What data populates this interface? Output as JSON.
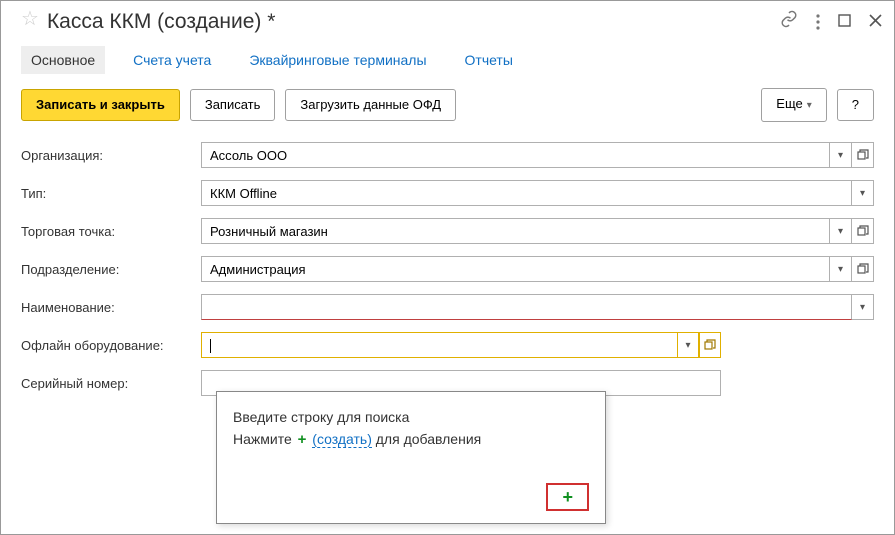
{
  "title": "Касса ККМ (создание) *",
  "tabs": {
    "main": "Основное",
    "accounts": "Счета учета",
    "terminals": "Эквайринговые терминалы",
    "reports": "Отчеты"
  },
  "toolbar": {
    "save_close": "Записать и закрыть",
    "save": "Записать",
    "load_ofd": "Загрузить данные ОФД",
    "more": "Еще",
    "help": "?"
  },
  "fields": {
    "org": {
      "label": "Организация:",
      "value": "Ассоль ООО"
    },
    "type": {
      "label": "Тип:",
      "value": "ККМ Offline"
    },
    "store": {
      "label": "Торговая точка:",
      "value": "Розничный магазин"
    },
    "dept": {
      "label": "Подразделение:",
      "value": "Администрация"
    },
    "name": {
      "label": "Наименование:",
      "value": ""
    },
    "offline": {
      "label": "Офлайн оборудование:",
      "value": ""
    },
    "serial": {
      "label": "Серийный номер:",
      "value": ""
    }
  },
  "dropdown": {
    "search_hint": "Введите строку для поиска",
    "press": "Нажмите",
    "create": "(создать)",
    "for_add": "для добавления"
  }
}
